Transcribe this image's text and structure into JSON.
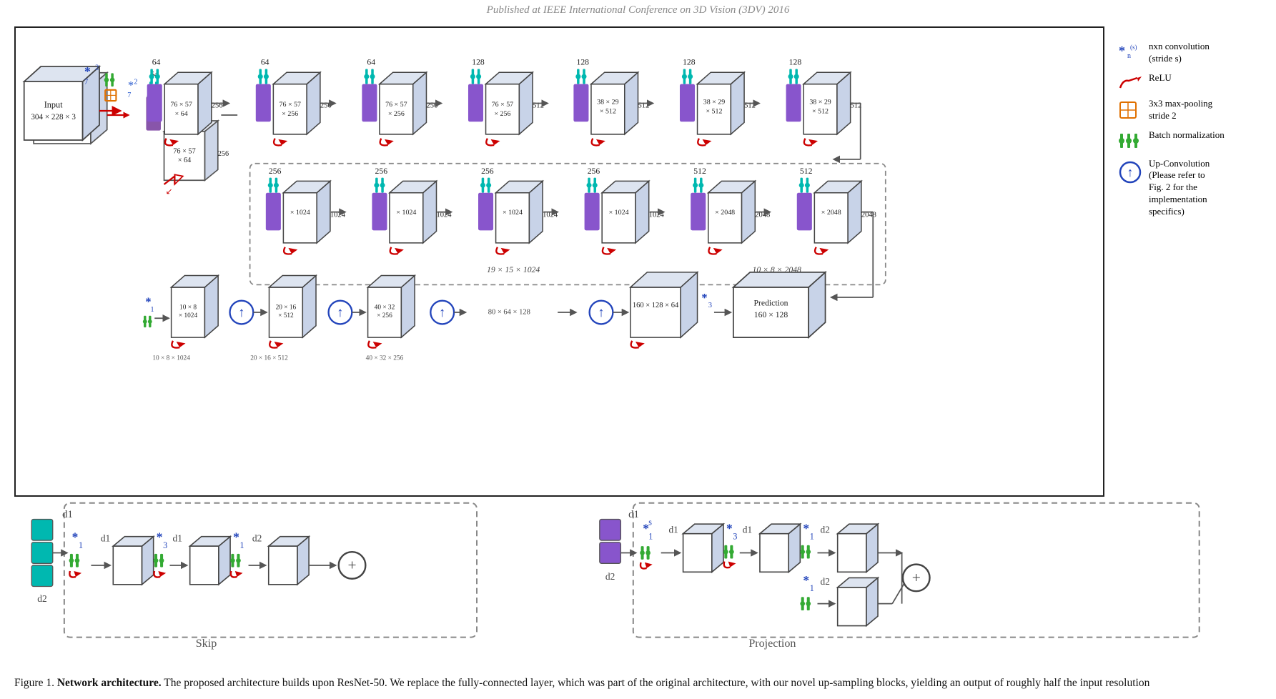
{
  "header": {
    "text": "Published at IEEE International Conference on 3D Vision (3DV) 2016"
  },
  "legend": {
    "items": [
      {
        "id": "conv",
        "label": "nxn convolution\n(stride s)",
        "icon": "star"
      },
      {
        "id": "relu",
        "label": "ReLU",
        "icon": "relu"
      },
      {
        "id": "maxpool",
        "label": "3x3 max-pooling\nstride 2",
        "icon": "grid"
      },
      {
        "id": "bn",
        "label": "Batch normalization",
        "icon": "bn"
      },
      {
        "id": "upconv",
        "label": "Up-Convolution\n(Please refer to\nFig. 2 for the\nimplementation\nspecifics)",
        "icon": "uparrow"
      }
    ]
  },
  "caption": {
    "prefix": "Figure 1.",
    "bold": "Network architecture.",
    "text": " The proposed architecture builds upon ResNet-50.  We replace the fully-connected layer, which was part of the original architecture, with our novel up-sampling blocks, yielding an output of roughly half the input resolution"
  }
}
